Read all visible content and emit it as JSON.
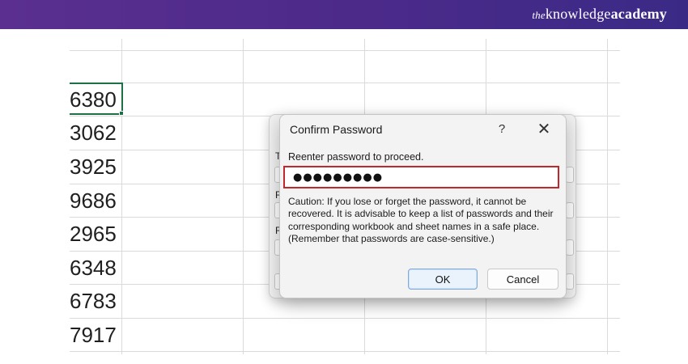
{
  "banner": {
    "brand_the": "the",
    "brand_knowledge": "knowledge",
    "brand_academy": "academy"
  },
  "sheet": {
    "column_values": [
      "6380",
      "3062",
      "3925",
      "9686",
      "2965",
      "6348",
      "6783",
      "7917"
    ]
  },
  "parent_dialog": {
    "labels": [
      "T",
      "R",
      "R"
    ]
  },
  "dialog": {
    "title": "Confirm Password",
    "help_icon": "?",
    "close_icon": "✕",
    "prompt": "Reenter password to proceed.",
    "password_value": "●●●●●●●●●",
    "caution_text": "Caution: If you lose or forget the password, it cannot be recovered. It is advisable to keep a list of passwords and their corresponding workbook and sheet names in a safe place.  (Remember that passwords are case-sensitive.)",
    "ok_label": "OK",
    "cancel_label": "Cancel"
  },
  "colors": {
    "banner": "#4b2a8a",
    "active_cell_border": "#1e7145",
    "input_focus_border": "#c0282d",
    "ok_border": "#7fa9d6"
  }
}
